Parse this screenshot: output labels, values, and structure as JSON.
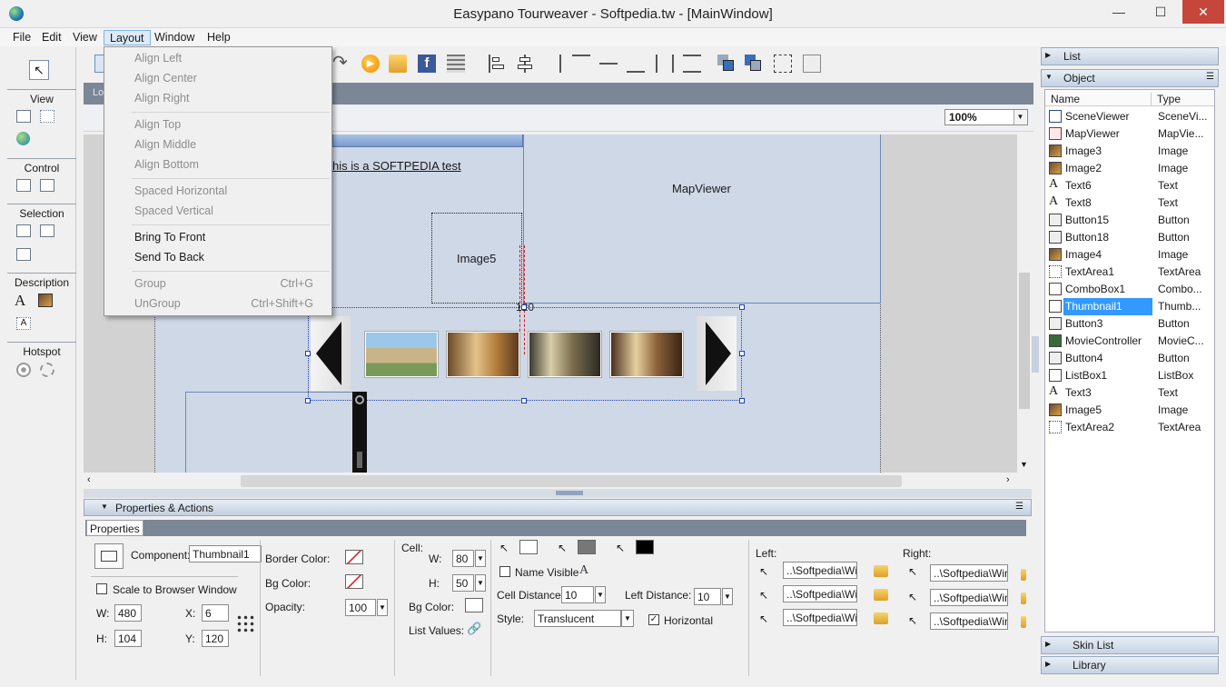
{
  "window": {
    "title": "Easypano Tourweaver - Softpedia.tw - [MainWindow]",
    "minimize": "—",
    "maximize": "☐",
    "close": "✕"
  },
  "menubar": [
    "File",
    "Edit",
    "View",
    "Layout",
    "Window",
    "Help"
  ],
  "layout_menu": {
    "items": [
      {
        "label": "Align Left",
        "enabled": false
      },
      {
        "label": "Align Center",
        "enabled": false
      },
      {
        "label": "Align Right",
        "enabled": false
      },
      {
        "label": "Align Top",
        "enabled": false
      },
      {
        "label": "Align Middle",
        "enabled": false
      },
      {
        "label": "Align Bottom",
        "enabled": false
      },
      {
        "label": "Spaced Horizontal",
        "enabled": false
      },
      {
        "label": "Spaced Vertical",
        "enabled": false
      },
      {
        "label": "Bring To Front",
        "enabled": true
      },
      {
        "label": "Send To Back",
        "enabled": true
      },
      {
        "label": "Group",
        "enabled": false,
        "shortcut": "Ctrl+G"
      },
      {
        "label": "UnGroup",
        "enabled": false,
        "shortcut": "Ctrl+Shift+G"
      }
    ]
  },
  "left_panel": {
    "sections": [
      "View",
      "Control",
      "Selection",
      "Description",
      "Hotspot"
    ]
  },
  "canvas": {
    "tab_label": "Lo",
    "zoom": "100%",
    "text_component": "his is a SOFTPEDIA test",
    "mapviewer_label": "MapViewer",
    "image5_label": "Image5",
    "offset_label": "120"
  },
  "right_panel": {
    "list_header": "List",
    "object_header": "Object",
    "col_name": "Name",
    "col_type": "Type",
    "objects": [
      {
        "name": "SceneViewer",
        "type": "SceneVi..."
      },
      {
        "name": "MapViewer",
        "type": "MapVie..."
      },
      {
        "name": "Image3",
        "type": "Image"
      },
      {
        "name": "Image2",
        "type": "Image"
      },
      {
        "name": "Text6",
        "type": "Text"
      },
      {
        "name": "Text8",
        "type": "Text"
      },
      {
        "name": "Button15",
        "type": "Button"
      },
      {
        "name": "Button18",
        "type": "Button"
      },
      {
        "name": "Image4",
        "type": "Image"
      },
      {
        "name": "TextArea1",
        "type": "TextArea"
      },
      {
        "name": "ComboBox1",
        "type": "Combo..."
      },
      {
        "name": "Thumbnail1",
        "type": "Thumb..."
      },
      {
        "name": "Button3",
        "type": "Button"
      },
      {
        "name": "MovieController",
        "type": "MovieC..."
      },
      {
        "name": "Button4",
        "type": "Button"
      },
      {
        "name": "ListBox1",
        "type": "ListBox"
      },
      {
        "name": "Text3",
        "type": "Text"
      },
      {
        "name": "Image5",
        "type": "Image"
      },
      {
        "name": "TextArea2",
        "type": "TextArea"
      }
    ],
    "skin_list": "Skin List",
    "library": "Library"
  },
  "properties": {
    "header": "Properties & Actions",
    "tab": "Properties",
    "component_label": "Component:",
    "component_value": "Thumbnail1",
    "scale_label": "Scale to Browser Window",
    "w_label": "W:",
    "w_value": "480",
    "h_label": "H:",
    "h_value": "104",
    "x_label": "X:",
    "x_value": "6",
    "y_label": "Y:",
    "y_value": "120",
    "border_color": "Border Color:",
    "bg_color": "Bg Color:",
    "opacity": "Opacity:",
    "opacity_value": "100",
    "cell": "Cell:",
    "cell_w_label": "W:",
    "cell_w": "80",
    "cell_h_label": "H:",
    "cell_h": "50",
    "cell_bg": "Bg Color:",
    "list_values": "List Values:",
    "name_visible": "Name Visible",
    "cell_distance": "Cell Distance:",
    "cell_distance_value": "10",
    "left_distance": "Left Distance:",
    "left_distance_value": "10",
    "style": "Style:",
    "style_value": "Translucent",
    "horizontal": "Horizontal",
    "left": "Left:",
    "right": "Right:",
    "paths": [
      "..\\Softpedia\\Wi",
      "..\\Softpedia\\Wi",
      "..\\Softpedia\\Wi"
    ],
    "right_paths": [
      "..\\Softpedia\\Win",
      "..\\Softpedia\\Win",
      "..\\Softpedia\\Win"
    ]
  }
}
